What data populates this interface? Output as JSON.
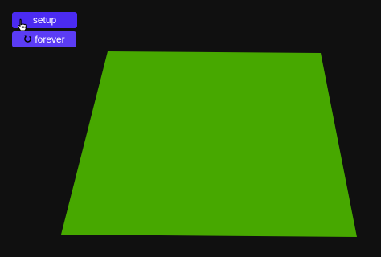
{
  "controls": {
    "setup_label": "setup",
    "forever_label": "forever"
  },
  "icons": {
    "forever": "refresh-icon",
    "cursor": "hand-pointer-icon"
  },
  "colors": {
    "background": "#101010",
    "plane": "#47a800",
    "setup_button": "#4b2bf2",
    "forever_button": "#5b3cf5",
    "button_text": "#ffffff"
  }
}
